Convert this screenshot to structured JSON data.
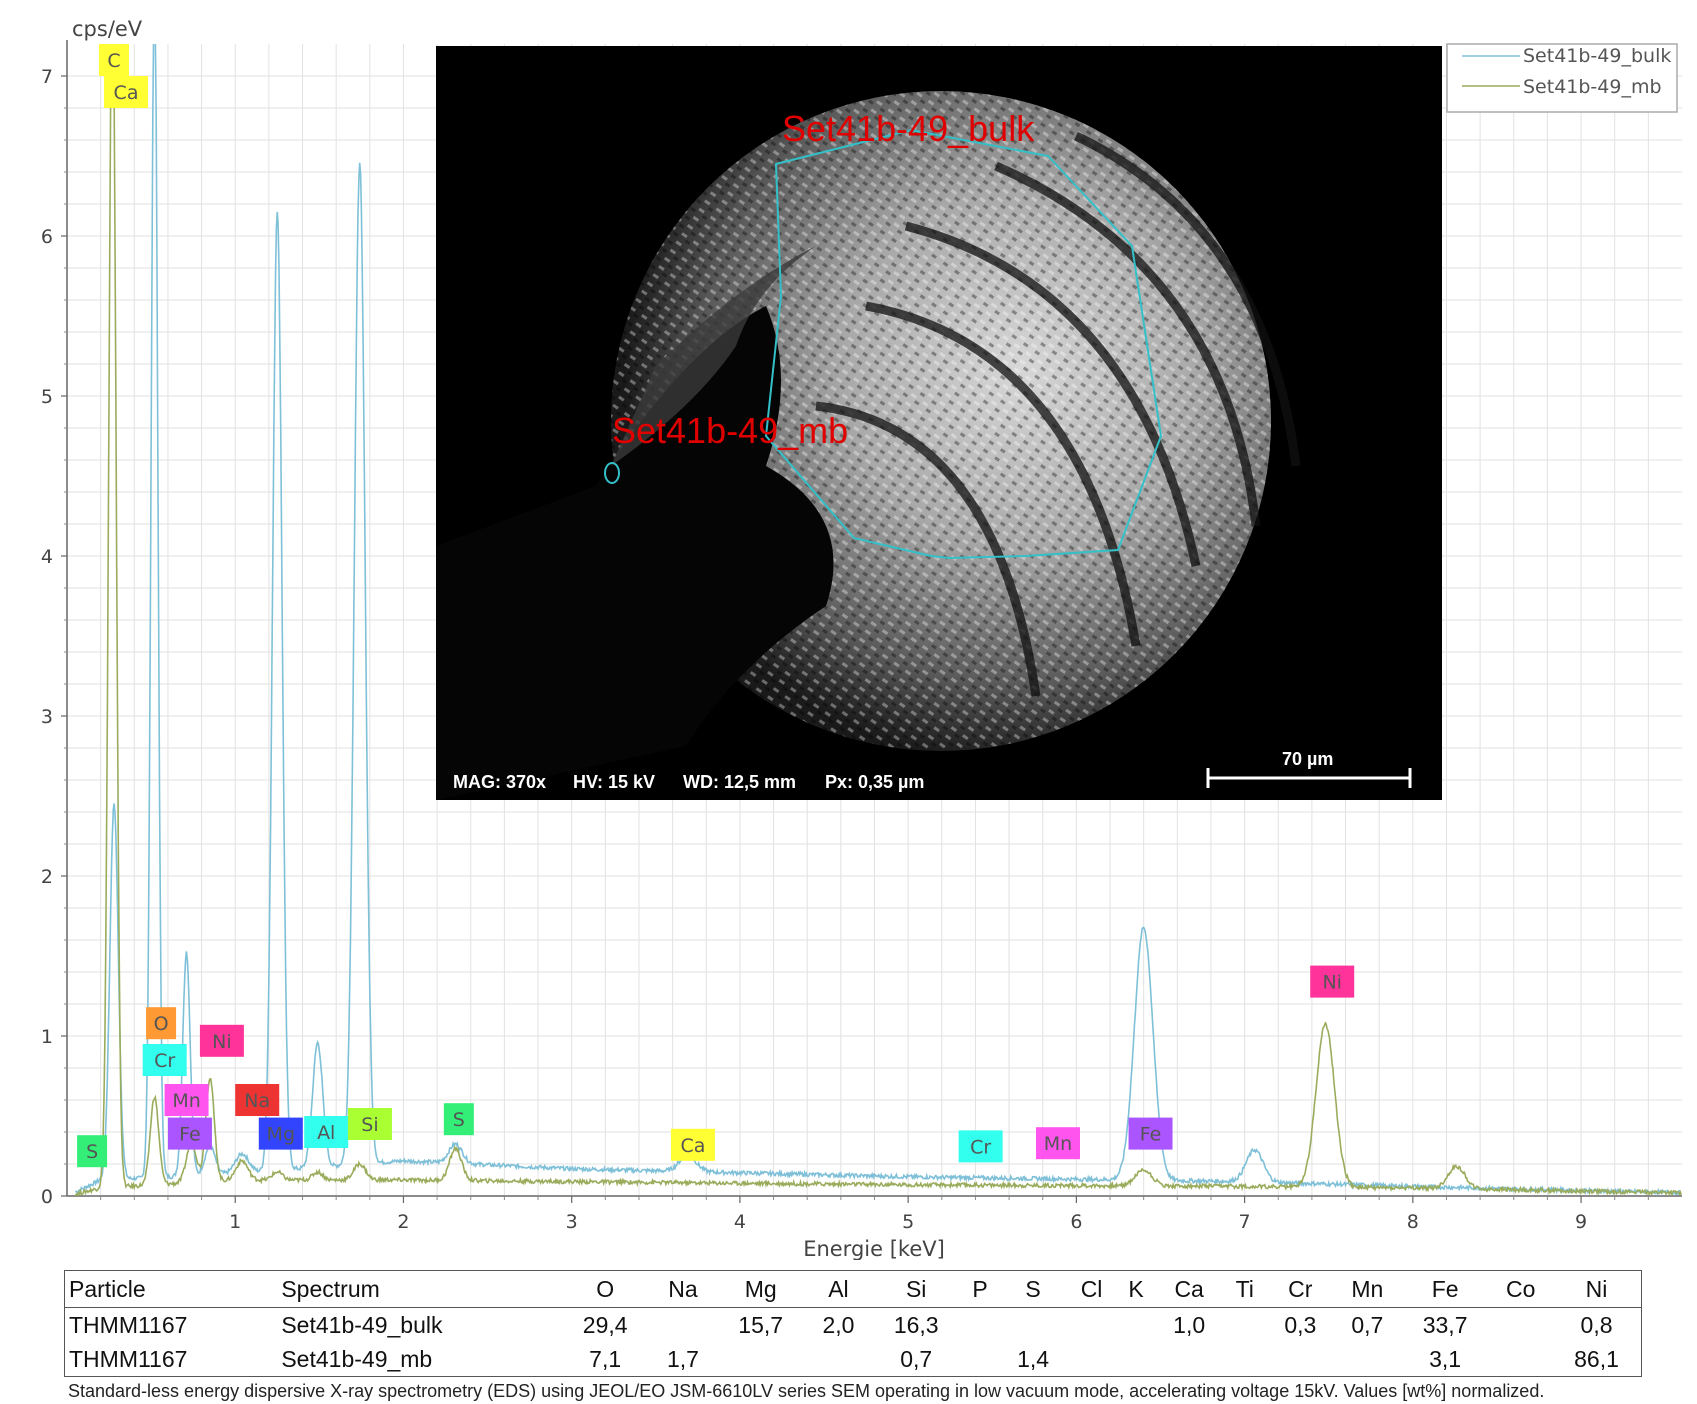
{
  "chart_data": {
    "type": "line",
    "ylabel": "cps/eV",
    "xlabel": "Energie [keV]",
    "xlim": [
      0,
      9.6
    ],
    "ylim": [
      0,
      7.2
    ],
    "xticks": [
      "1",
      "2",
      "3",
      "4",
      "5",
      "6",
      "7",
      "8",
      "9"
    ],
    "yticks": [
      "0",
      "1",
      "2",
      "3",
      "4",
      "5",
      "6",
      "7"
    ],
    "grid": true,
    "legend": {
      "placement": "top-right",
      "entries": [
        "Set41b-49_bulk",
        "Set41b-49_mb"
      ]
    },
    "series": [
      {
        "name": "Set41b-49_bulk",
        "color": "#7ec0d8",
        "baseline": [
          [
            0.2,
            0.1
          ],
          [
            1.0,
            0.14
          ],
          [
            2.0,
            0.22
          ],
          [
            3.0,
            0.17
          ],
          [
            5.0,
            0.12
          ],
          [
            7.0,
            0.09
          ],
          [
            8.0,
            0.06
          ],
          [
            9.6,
            0.02
          ]
        ],
        "peaks": [
          {
            "x": 0.28,
            "height": 2.35,
            "w": 0.025
          },
          {
            "x": 0.52,
            "height": 7.5,
            "w": 0.02
          },
          {
            "x": 0.71,
            "height": 1.4,
            "w": 0.022
          },
          {
            "x": 0.85,
            "height": 0.18,
            "w": 0.03
          },
          {
            "x": 1.04,
            "height": 0.12,
            "w": 0.04
          },
          {
            "x": 1.25,
            "height": 6.0,
            "w": 0.028
          },
          {
            "x": 1.49,
            "height": 0.78,
            "w": 0.03
          },
          {
            "x": 1.74,
            "height": 6.25,
            "w": 0.032
          },
          {
            "x": 2.31,
            "height": 0.12,
            "w": 0.04
          },
          {
            "x": 3.69,
            "height": 0.1,
            "w": 0.05
          },
          {
            "x": 6.4,
            "height": 1.58,
            "w": 0.055
          },
          {
            "x": 7.06,
            "height": 0.2,
            "w": 0.05
          }
        ]
      },
      {
        "name": "Set41b-49_mb",
        "color": "#9aac5c",
        "baseline": [
          [
            0.2,
            0.05
          ],
          [
            1.0,
            0.1
          ],
          [
            2.0,
            0.1
          ],
          [
            3.0,
            0.09
          ],
          [
            5.0,
            0.07
          ],
          [
            7.0,
            0.06
          ],
          [
            8.0,
            0.05
          ],
          [
            9.6,
            0.02
          ]
        ],
        "peaks": [
          {
            "x": 0.27,
            "height": 7.6,
            "w": 0.022
          },
          {
            "x": 0.52,
            "height": 0.55,
            "w": 0.025
          },
          {
            "x": 0.74,
            "height": 0.25,
            "w": 0.03
          },
          {
            "x": 0.85,
            "height": 0.65,
            "w": 0.025
          },
          {
            "x": 1.04,
            "height": 0.12,
            "w": 0.035
          },
          {
            "x": 1.25,
            "height": 0.05,
            "w": 0.03
          },
          {
            "x": 1.49,
            "height": 0.05,
            "w": 0.03
          },
          {
            "x": 1.74,
            "height": 0.1,
            "w": 0.035
          },
          {
            "x": 2.31,
            "height": 0.2,
            "w": 0.035
          },
          {
            "x": 6.4,
            "height": 0.1,
            "w": 0.05
          },
          {
            "x": 7.48,
            "height": 1.02,
            "w": 0.055
          },
          {
            "x": 8.26,
            "height": 0.14,
            "w": 0.05
          }
        ]
      }
    ],
    "element_labels": [
      {
        "text": "C",
        "x": 0.19,
        "y": 7.0,
        "color": "#ffff33"
      },
      {
        "text": "Ca",
        "x": 0.22,
        "y": 6.8,
        "color": "#ffff33"
      },
      {
        "text": "S",
        "x": 0.06,
        "y": 0.18,
        "color": "#33ee77"
      },
      {
        "text": "O",
        "x": 0.47,
        "y": 0.98,
        "color": "#ff9933"
      },
      {
        "text": "Cr",
        "x": 0.45,
        "y": 0.75,
        "color": "#33ffee"
      },
      {
        "text": "Ni",
        "x": 0.79,
        "y": 0.87,
        "color": "#ff3399"
      },
      {
        "text": "Mn",
        "x": 0.58,
        "y": 0.5,
        "color": "#ff55ee"
      },
      {
        "text": "Na",
        "x": 1.0,
        "y": 0.5,
        "color": "#ee3333"
      },
      {
        "text": "Fe",
        "x": 0.6,
        "y": 0.29,
        "color": "#aa55ff"
      },
      {
        "text": "Mg",
        "x": 1.14,
        "y": 0.29,
        "color": "#3344ff"
      },
      {
        "text": "Al",
        "x": 1.41,
        "y": 0.3,
        "color": "#33ffee"
      },
      {
        "text": "Si",
        "x": 1.67,
        "y": 0.35,
        "color": "#aaff33"
      },
      {
        "text": "S",
        "x": 2.24,
        "y": 0.38,
        "color": "#33ee77"
      },
      {
        "text": "Ca",
        "x": 3.59,
        "y": 0.22,
        "color": "#ffff33"
      },
      {
        "text": "Cr",
        "x": 5.3,
        "y": 0.21,
        "color": "#33ffee"
      },
      {
        "text": "Mn",
        "x": 5.76,
        "y": 0.23,
        "color": "#ff55ee"
      },
      {
        "text": "Fe",
        "x": 6.31,
        "y": 0.29,
        "color": "#aa55ff"
      },
      {
        "text": "Ni",
        "x": 7.39,
        "y": 1.24,
        "color": "#ff3399"
      }
    ]
  },
  "sem_image": {
    "label_bulk": "Set41b-49_bulk",
    "label_mb": "Set41b-49_mb",
    "meta_mag": "MAG: 370x",
    "meta_hv": "HV: 15 kV",
    "meta_wd": "WD: 12,5 mm",
    "meta_px": "Px: 0,35 µm",
    "scale_bar": "70 µm"
  },
  "table": {
    "headers": [
      "Particle",
      "Spectrum",
      "O",
      "Na",
      "Mg",
      "Al",
      "Si",
      "P",
      "S",
      "Cl",
      "K",
      "Ca",
      "Ti",
      "Cr",
      "Mn",
      "Fe",
      "Co",
      "Ni"
    ],
    "rows": [
      [
        "THMM1167",
        "Set41b-49_bulk",
        "29,4",
        "",
        "15,7",
        "2,0",
        "16,3",
        "",
        "",
        "",
        "",
        "1,0",
        "",
        "0,3",
        "0,7",
        "33,7",
        "",
        "0,8"
      ],
      [
        "THMM1167",
        "Set41b-49_mb",
        "7,1",
        "1,7",
        "",
        "",
        "0,7",
        "",
        "1,4",
        "",
        "",
        "",
        "",
        "",
        "",
        "3,1",
        "",
        "86,1"
      ]
    ]
  },
  "caption": "Standard-less energy dispersive X-ray spectrometry (EDS) using JEOL/EO JSM-6610LV series SEM operating in low vacuum mode, accelerating voltage 15kV. Values [wt%] normalized."
}
